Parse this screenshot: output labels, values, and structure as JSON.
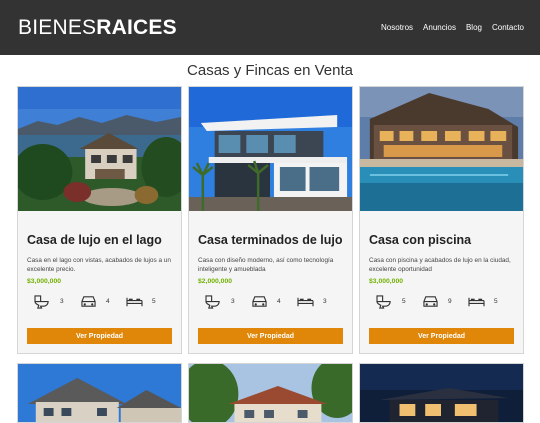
{
  "header": {
    "logo_light": "BIENES",
    "logo_bold": "RAICES",
    "nav": [
      "Nosotros",
      "Anuncios",
      "Blog",
      "Contacto"
    ]
  },
  "section_title": "Casas y Fincas en Venta",
  "listings": [
    {
      "title": "Casa de lujo en el lago",
      "description": "Casa en el lago con vistas, acabados de lujos a un excelente precio.",
      "price": "$3,000,000",
      "bathrooms": "3",
      "parking": "4",
      "bedrooms": "5",
      "button": "Ver Propiedad"
    },
    {
      "title": "Casa terminados de lujo",
      "description": "Casa con diseño moderno, así como tecnología inteligente y amueblada",
      "price": "$2,000,000",
      "bathrooms": "3",
      "parking": "4",
      "bedrooms": "3",
      "button": "Ver Propiedad"
    },
    {
      "title": "Casa con piscina",
      "description": "Casa con piscina y acabados de lujo en la ciudad, excelente oportunidad",
      "price": "$3,000,000",
      "bathrooms": "5",
      "parking": "9",
      "bedrooms": "5",
      "button": "Ver Propiedad"
    }
  ],
  "colors": {
    "header_bg": "#333333",
    "price": "#71b100",
    "button": "#e08709"
  },
  "icons": [
    "toilet-icon",
    "car-icon",
    "bed-icon"
  ]
}
